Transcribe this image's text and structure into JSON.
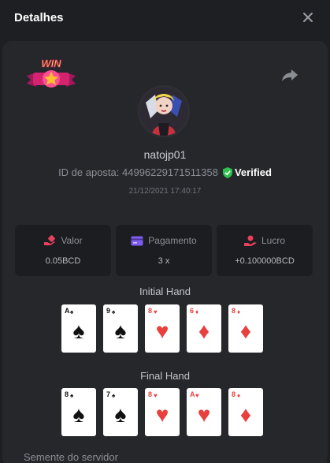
{
  "header": {
    "title": "Detalhes"
  },
  "badge": {
    "text": "WIN"
  },
  "user": {
    "name": "natojp01",
    "bet_id_label": "ID de aposta: 44996229171511358",
    "verified_label": "Verified",
    "timestamp": "21/12/2021 17:40:17"
  },
  "stats": [
    {
      "label": "Valor",
      "value": "0.05BCD",
      "icon": "coin-hand-icon",
      "color": "#e8405a"
    },
    {
      "label": "Pagamento",
      "value": "3 x",
      "icon": "card-icon",
      "color": "#7d5cf0"
    },
    {
      "label": "Lucro",
      "value": "+0.100000BCD",
      "icon": "profit-icon",
      "color": "#e8405a"
    }
  ],
  "initial_hand": {
    "title": "Initial Hand",
    "cards": [
      {
        "rank": "A",
        "suit": "♠",
        "color": "black"
      },
      {
        "rank": "9",
        "suit": "♠",
        "color": "black"
      },
      {
        "rank": "8",
        "suit": "♥",
        "color": "red"
      },
      {
        "rank": "6",
        "suit": "♦",
        "color": "red"
      },
      {
        "rank": "8",
        "suit": "♦",
        "color": "red"
      }
    ]
  },
  "final_hand": {
    "title": "Final Hand",
    "cards": [
      {
        "rank": "8",
        "suit": "♠",
        "color": "black"
      },
      {
        "rank": "7",
        "suit": "♠",
        "color": "black"
      },
      {
        "rank": "8",
        "suit": "♥",
        "color": "red"
      },
      {
        "rank": "A",
        "suit": "♥",
        "color": "red"
      },
      {
        "rank": "8",
        "suit": "♦",
        "color": "red"
      }
    ]
  },
  "seed": {
    "label": "Semente do servidor"
  }
}
